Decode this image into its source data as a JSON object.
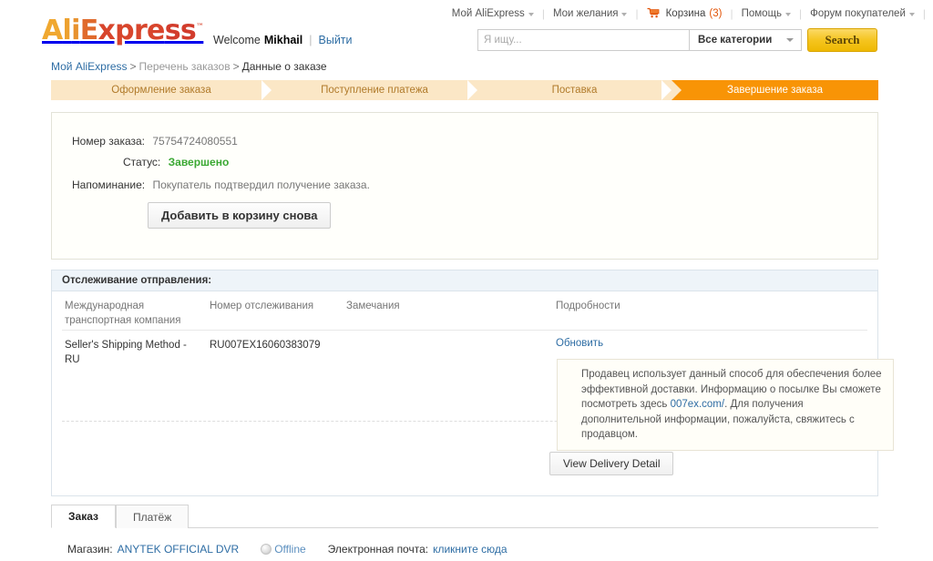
{
  "topnav": {
    "items": [
      {
        "label": "Мой AliExpress",
        "caret": true,
        "icon": null
      },
      {
        "label": "Мои желания",
        "caret": true,
        "icon": null
      },
      {
        "label": "Корзина",
        "count": "(3)",
        "caret": false,
        "icon": "cart-icon"
      },
      {
        "label": "Помощь",
        "caret": true,
        "icon": null
      },
      {
        "label": "Форум покупателей",
        "caret": true,
        "icon": null
      }
    ]
  },
  "logo": {
    "part_a": "A",
    "part_l": "l",
    "part_i": "i",
    "part_e": "E",
    "part_xpre": "xpre",
    "part_ss": "ss",
    "tm": "™"
  },
  "welcome": {
    "greeting": "Welcome",
    "username": "Mikhail",
    "divider": "|",
    "logout": "Выйти"
  },
  "search": {
    "placeholder": "Я ищу...",
    "value": "",
    "category": "Все категории",
    "button": "Search"
  },
  "breadcrumb": {
    "item1": "Мой AliExpress",
    "sep1": ">",
    "item2": "Перечень заказов",
    "sep2": ">",
    "item3": "Данные о заказе"
  },
  "steps": [
    {
      "label": "Оформление заказа",
      "active": false
    },
    {
      "label": "Поступление платежа",
      "active": false
    },
    {
      "label": "Поставка",
      "active": false
    },
    {
      "label": "Завершение заказа",
      "active": true
    }
  ],
  "order": {
    "number_label": "Номер заказа:",
    "number_value": "75754724080551",
    "status_label": "Статус:",
    "status_value": "Завершено",
    "reminder_label": "Напоминание:",
    "reminder_value": "Покупатель подтвердил получение заказа.",
    "add_to_cart_button": "Добавить в корзину снова"
  },
  "tracking": {
    "title": "Отслеживание отправления:",
    "columns": {
      "carrier_line1": "Международная",
      "carrier_line2": "транспортная компания",
      "tracking_no": "Номер отслеживания",
      "notes": "Замечания",
      "details": "Подробности"
    },
    "row": {
      "carrier_line1": "Seller's Shipping Method -",
      "carrier_line2": "RU",
      "tracking_no": "RU007EX16060383079",
      "notes": ""
    },
    "update_link": "Обновить",
    "info_text_1": "Продавец использует данный способ для обеспечения более эффективной доставки. Информацию о посылке Вы сможете посмотреть здесь ",
    "info_link": "007ex.com/",
    "info_text_2": ". Для получения дополнительной информации, пожалуйста, свяжитесь с продавцом.",
    "delivery_button": "View Delivery Detail"
  },
  "tabs": [
    {
      "label": "Заказ",
      "active": true
    },
    {
      "label": "Платёж",
      "active": false
    }
  ],
  "store": {
    "label": "Магазин:",
    "name": "ANYTEK OFFICIAL DVR",
    "status": "Offline",
    "email_label": "Электронная почта:",
    "email_link": "кликните сюда"
  },
  "colors": {
    "accent_orange": "#f89406",
    "step_bg": "#fbe7c6",
    "link_blue": "#2e6da4",
    "status_green": "#3aa832",
    "cart_orange": "#e25306"
  }
}
